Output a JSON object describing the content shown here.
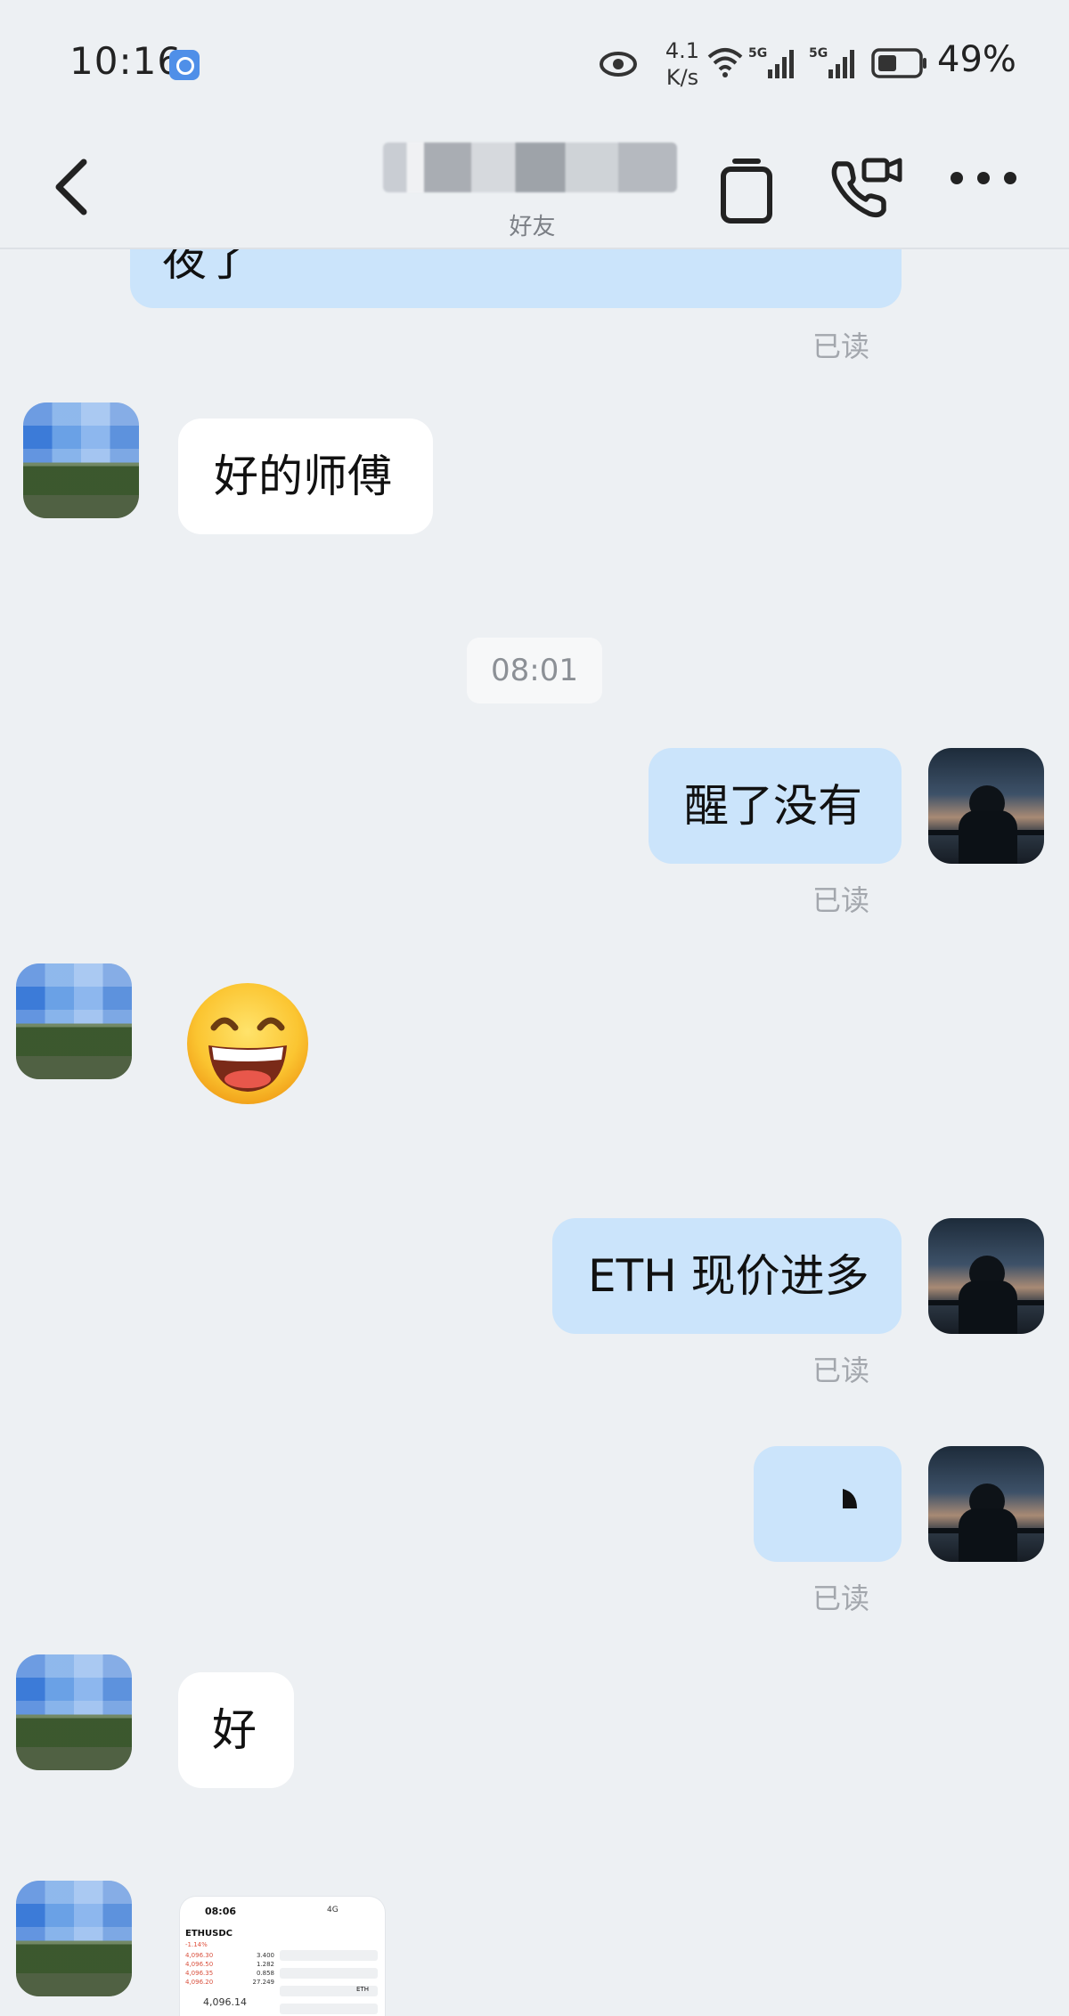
{
  "status_bar": {
    "time": "10:16",
    "net_speed_value": "4.1",
    "net_speed_unit": "K/s",
    "signal_1_label": "5G",
    "signal_2_label": "5G",
    "battery_percent": "49%"
  },
  "header": {
    "title": "",
    "subtitle": "好友",
    "icons": [
      "back-icon",
      "phone-tab-icon",
      "video-call-icon",
      "more-icon"
    ]
  },
  "messages": [
    {
      "from": "self",
      "text": "夜了",
      "status": "已读"
    },
    {
      "from": "other",
      "text": "好的师傅"
    },
    {
      "type": "time",
      "text": "08:01"
    },
    {
      "from": "self",
      "text": "醒了没有",
      "status": "已读"
    },
    {
      "from": "other",
      "type": "emoji",
      "emoji": "grinning-face"
    },
    {
      "from": "self",
      "text": "ETH 现价进多",
      "status": "已读"
    },
    {
      "from": "self",
      "type": "shape",
      "status": "已读"
    },
    {
      "from": "other",
      "text": "好"
    },
    {
      "from": "other",
      "type": "screenshot",
      "thumb": {
        "time": "08:06",
        "net": "4G",
        "pair": "ETHUSDC",
        "change": "-1.14%",
        "price": "4,096.14",
        "rows": [
          [
            "4,096.30",
            "3.400"
          ],
          [
            "4,096.50",
            "1.282"
          ],
          [
            "4,096.35",
            "0.858"
          ],
          [
            "4,096.20",
            "27.249"
          ]
        ],
        "asset": "ETH"
      }
    }
  ],
  "colors": {
    "background": "#edf0f3",
    "bubble_out": "#cbe4fb",
    "bubble_in": "#ffffff",
    "read_text": "#a3a7ad"
  }
}
